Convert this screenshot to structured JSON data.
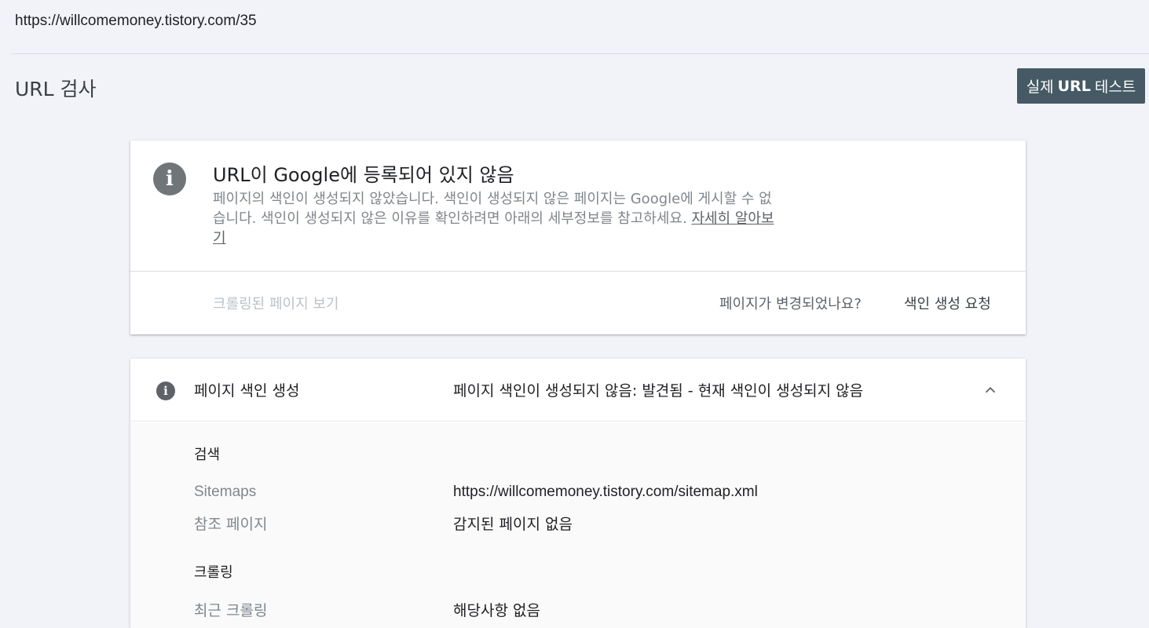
{
  "address": "https://willcomemoney.tistory.com/35",
  "header": {
    "title": "URL 검사",
    "test_button_pre": "실제",
    "test_button_bold": "URL",
    "test_button_post": "테스트"
  },
  "status": {
    "icon": "info-icon",
    "title": "URL이 Google에 등록되어 있지 않음",
    "description": "페이지의 색인이 생성되지 않았습니다. 색인이 생성되지 않은 페이지는 Google에 게시할 수 없습니다. 색인이 생성되지 않은 이유를 확인하려면 아래의 세부정보를 참고하세요.",
    "learn_more": "자세히 알아보기",
    "view_crawled": "크롤링된 페이지 보기",
    "page_changed": "페이지가 변경되었나요?",
    "request_indexing": "색인 생성 요청"
  },
  "indexing": {
    "icon": "info-icon",
    "label": "페이지 색인 생성",
    "value": "페이지 색인이 생성되지 않음: 발견됨 - 현재 색인이 생성되지 않음",
    "chevron": "chevron-up-icon",
    "sections": [
      {
        "heading": "검색",
        "rows": [
          {
            "label": "Sitemaps",
            "value": "https://willcomemoney.tistory.com/sitemap.xml"
          },
          {
            "label": "참조 페이지",
            "value": "감지된 페이지 없음"
          }
        ]
      },
      {
        "heading": "크롤링",
        "rows": [
          {
            "label": "최근 크롤링",
            "value": "해당사항 없음"
          }
        ]
      }
    ]
  },
  "colors": {
    "background": "#f1f3f9",
    "button": "#455a64",
    "icon": "#70757a"
  }
}
